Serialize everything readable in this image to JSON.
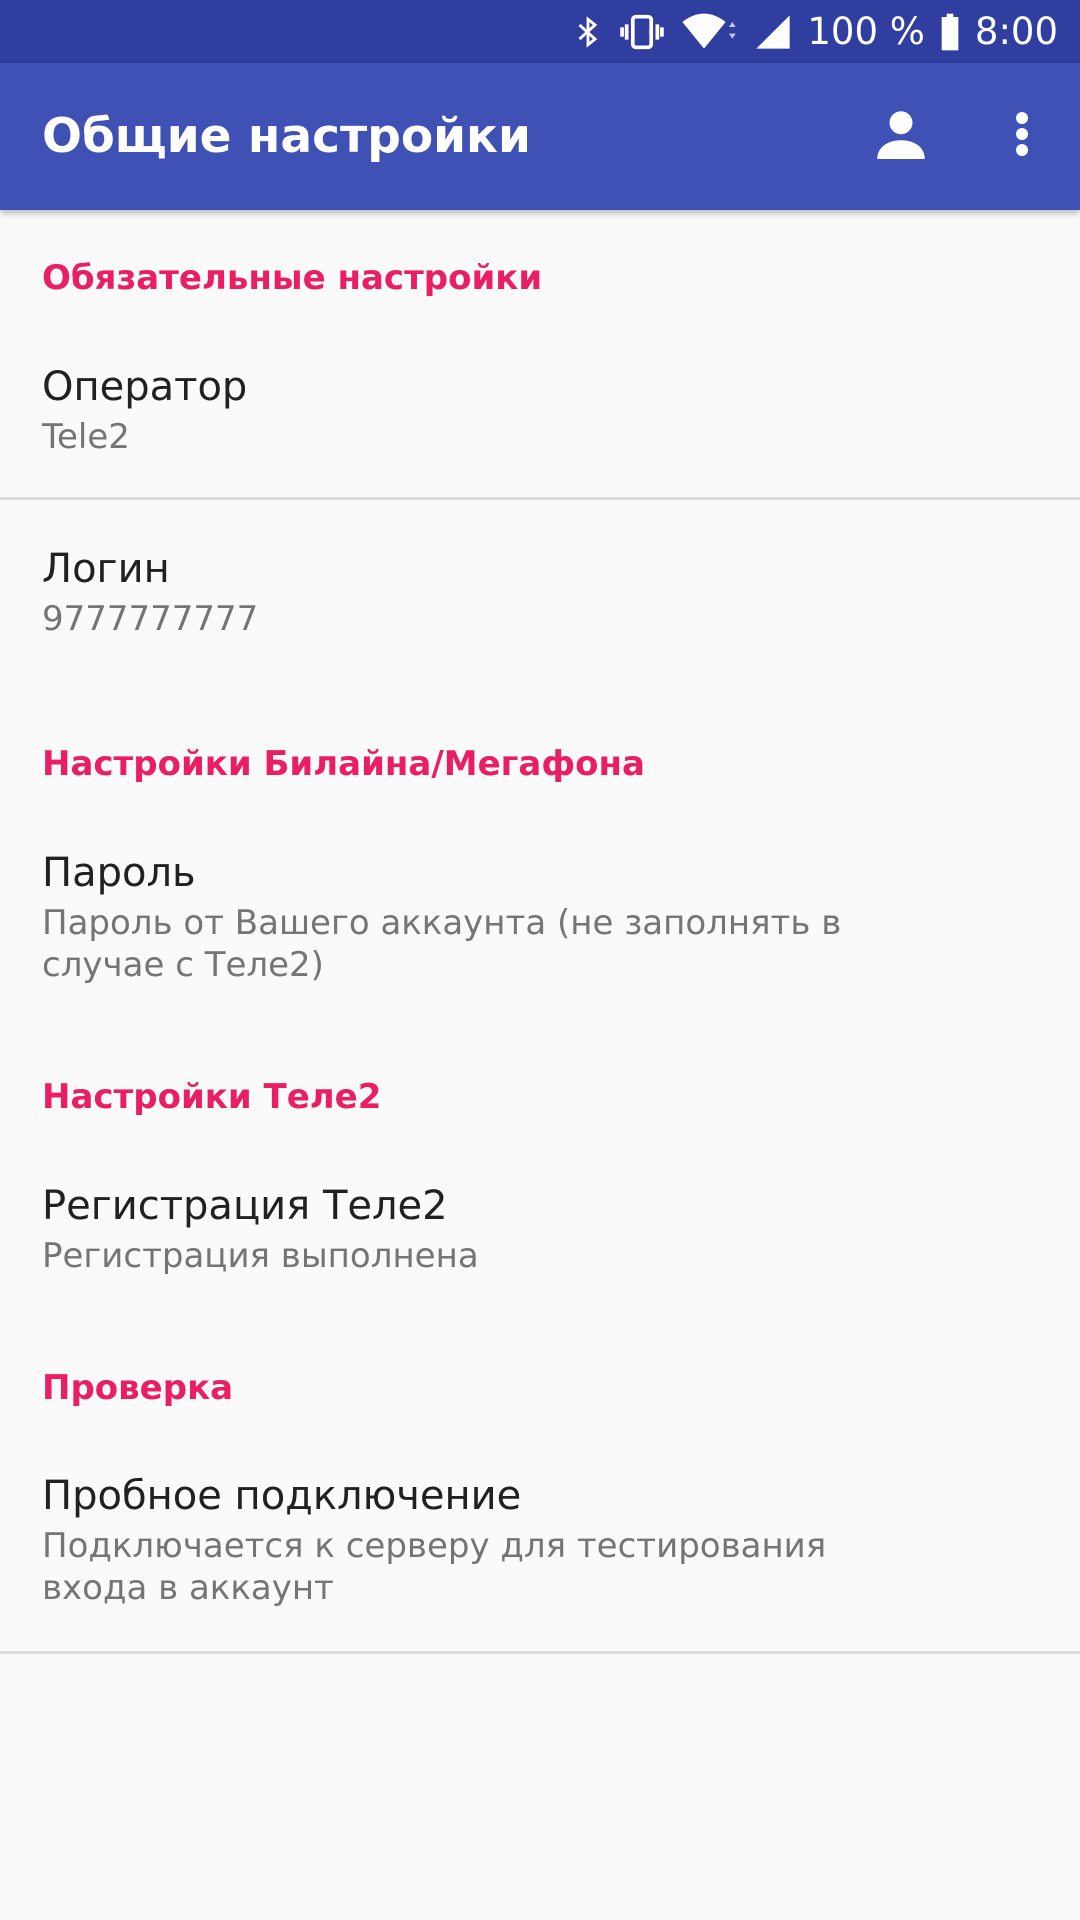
{
  "status_bar": {
    "battery_percent": "100 %",
    "time": "8:00",
    "icons": [
      "bluetooth-icon",
      "vibrate-icon",
      "wifi-icon",
      "signal-icon",
      "battery-icon"
    ]
  },
  "app_bar": {
    "title": "Общие настройки",
    "color": "#3f51b5",
    "actions": [
      "account-icon",
      "more-vert-icon"
    ]
  },
  "accent_color": "#e91e63",
  "sections": {
    "required": {
      "header": "Обязательные настройки",
      "operator": {
        "title": "Оператор",
        "summary": "Tele2"
      },
      "login": {
        "title": "Логин",
        "summary": "9777777777"
      }
    },
    "beeline_megafon": {
      "header": "Настройки Билайна/Мегафона",
      "password": {
        "title": "Пароль",
        "summary": "Пароль от Вашего аккаунта (не заполнять в случае с Теле2)"
      }
    },
    "tele2": {
      "header": "Настройки Теле2",
      "registration": {
        "title": "Регистрация Теле2",
        "summary": "Регистрация выполнена"
      }
    },
    "check": {
      "header": "Проверка",
      "test_connection": {
        "title": "Пробное подключение",
        "summary": "Подключается к серверу для тестирования входа в аккаунт"
      }
    }
  }
}
